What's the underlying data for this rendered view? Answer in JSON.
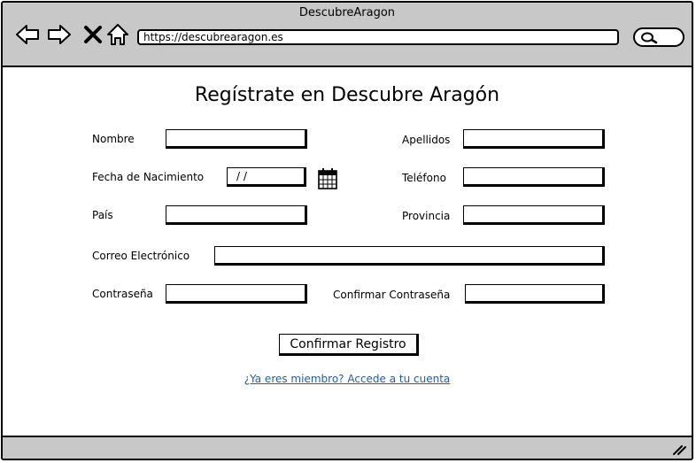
{
  "window": {
    "title": "DescubreAragon",
    "url": "https://descubrearagon.es"
  },
  "nav": {
    "back_icon": "back-arrow-icon",
    "forward_icon": "forward-arrow-icon",
    "stop_icon": "close-icon",
    "home_icon": "home-icon",
    "search_icon": "search-icon"
  },
  "form": {
    "heading": "Regístrate en Descubre Aragón",
    "labels": {
      "nombre": "Nombre",
      "apellidos": "Apellidos",
      "fecha": "Fecha de Nacimiento",
      "telefono": "Teléfono",
      "pais": "País",
      "provincia": "Provincia",
      "correo": "Correo Electrónico",
      "contrasena": "Contraseña",
      "confirmar": "Confirmar Contraseña"
    },
    "values": {
      "fecha": " /  /"
    },
    "submit_label": "Confirmar Registro",
    "login_link": "¿Ya eres miembro? Accede a tu cuenta"
  },
  "colors": {
    "chrome": "#c8c8c8",
    "link": "#1f5f9f"
  }
}
